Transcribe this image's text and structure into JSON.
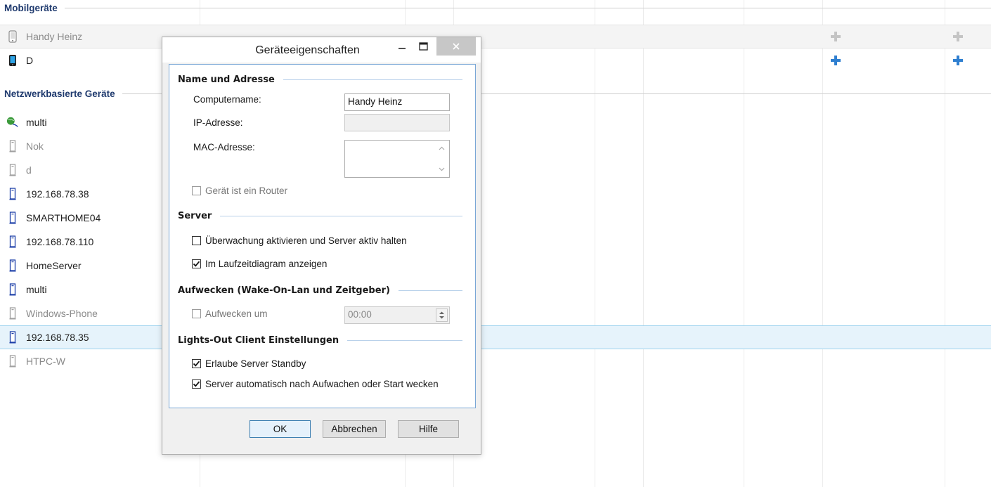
{
  "sections": {
    "mobile": "Mobilgeräte",
    "network": "Netzwerkbasierte Geräte"
  },
  "mobile_devices": [
    {
      "label": "Handy Heinz",
      "state": "dim"
    },
    {
      "label": "D",
      "state": "active"
    }
  ],
  "network_devices": [
    {
      "label": "multi",
      "state": "active",
      "icon": "network-globe-icon"
    },
    {
      "label": "Nok",
      "state": "dim",
      "icon": "computer-tower-icon"
    },
    {
      "label": "d",
      "state": "dim",
      "icon": "computer-tower-icon"
    },
    {
      "label": "192.168.78.38",
      "state": "active",
      "icon": "computer-tower-icon"
    },
    {
      "label": "SMARTHOME04",
      "state": "active",
      "icon": "computer-tower-icon"
    },
    {
      "label": "192.168.78.110",
      "state": "active",
      "icon": "computer-tower-icon"
    },
    {
      "label": "HomeServer",
      "state": "active",
      "icon": "computer-tower-icon"
    },
    {
      "label": "multi",
      "state": "active",
      "icon": "computer-tower-icon"
    },
    {
      "label": "Windows-Phone",
      "state": "dim",
      "icon": "computer-tower-icon"
    },
    {
      "label": "192.168.78.35",
      "state": "selected",
      "icon": "computer-tower-icon"
    },
    {
      "label": "HTPC-W",
      "state": "dim",
      "icon": "computer-tower-icon"
    }
  ],
  "dialog": {
    "title": "Geräteeigenschaften",
    "group_name": "Name und Adresse",
    "computername_label": "Computername:",
    "computername_value": "Handy Heinz",
    "ip_label": "IP-Adresse:",
    "ip_value": "",
    "mac_label": "MAC-Adresse:",
    "mac_value": "",
    "router_label": "Gerät ist ein Router",
    "router_checked": false,
    "group_server": "Server",
    "monitor_label": "Überwachung aktivieren und Server aktiv halten",
    "monitor_checked": false,
    "uptime_label": "Im Laufzeitdiagram anzeigen",
    "uptime_checked": true,
    "group_wake": "Aufwecken (Wake-On-Lan und Zeitgeber)",
    "wake_label": "Aufwecken um",
    "wake_checked": false,
    "wake_time": "00:00",
    "group_client": "Lights-Out Client Einstellungen",
    "standby_label": "Erlaube Server Standby",
    "standby_checked": true,
    "autowake_label": "Server automatisch nach Aufwachen oder Start wecken",
    "autowake_checked": true,
    "ok_label": "OK",
    "cancel_label": "Abbrechen",
    "help_label": "Hilfe"
  },
  "colors": {
    "section_title": "#1f3a6e",
    "selection_bg": "#e6f3fb",
    "plus_active": "#2f7fd0",
    "plus_dim": "#c4c4c4",
    "device_icon": "#1c3fa8"
  }
}
